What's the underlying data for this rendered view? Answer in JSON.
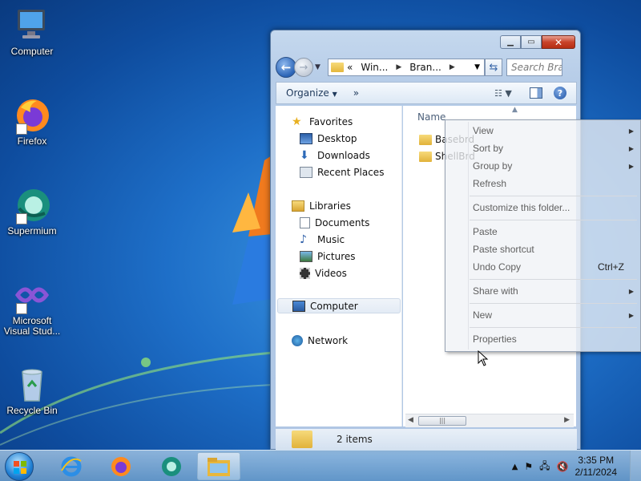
{
  "desktop": {
    "icons": [
      {
        "label": "Computer"
      },
      {
        "label": "Firefox"
      },
      {
        "label": "Supermium"
      },
      {
        "label_line1": "Microsoft",
        "label_line2": "Visual Stud..."
      },
      {
        "label": "Recycle Bin"
      }
    ]
  },
  "explorer": {
    "address": {
      "overflow": "«",
      "crumbs": [
        "Win...",
        "Bran..."
      ]
    },
    "search_placeholder": "Search Bra...",
    "toolbar": {
      "organize": "Organize",
      "more": "»"
    },
    "nav": {
      "favorites": "Favorites",
      "desktop": "Desktop",
      "downloads": "Downloads",
      "recent_places": "Recent Places",
      "libraries": "Libraries",
      "documents": "Documents",
      "music": "Music",
      "pictures": "Pictures",
      "videos": "Videos",
      "computer": "Computer",
      "network": "Network"
    },
    "column_name": "Name",
    "files": [
      "Basebrd",
      "ShellBrd"
    ],
    "status": "2 items"
  },
  "context_menu": {
    "view": "View",
    "sort_by": "Sort by",
    "group_by": "Group by",
    "refresh": "Refresh",
    "customize": "Customize this folder...",
    "paste": "Paste",
    "paste_shortcut": "Paste shortcut",
    "undo_copy": "Undo Copy",
    "undo_shortcut": "Ctrl+Z",
    "share_with": "Share with",
    "new": "New",
    "properties": "Properties"
  },
  "taskbar": {
    "time": "3:35 PM",
    "date": "2/11/2024"
  }
}
